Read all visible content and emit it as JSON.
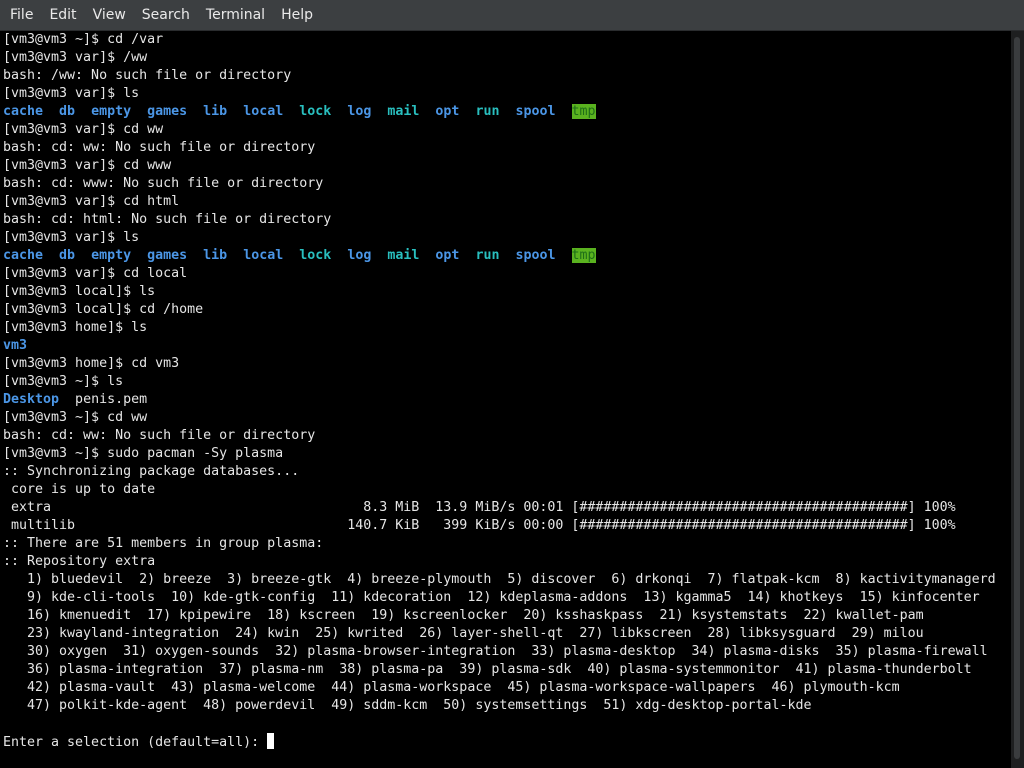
{
  "menu": {
    "items": [
      "File",
      "Edit",
      "View",
      "Search",
      "Terminal",
      "Help"
    ]
  },
  "colors": {
    "menubar_bg": "#3c3f41",
    "terminal_bg": "#000000",
    "text": "#e6e6e6",
    "dir_blue": "#4b96e6",
    "dir_cyan": "#29bfbf",
    "tmp_bg": "#5ab21f"
  },
  "terminal": {
    "lines": [
      [
        {
          "t": "[vm3@vm3 ~]$ cd /var"
        }
      ],
      [
        {
          "t": "[vm3@vm3 var]$ /ww"
        }
      ],
      [
        {
          "t": "bash: /ww: No such file or directory"
        }
      ],
      [
        {
          "t": "[vm3@vm3 var]$ ls"
        }
      ],
      [
        {
          "t": "cache",
          "c": "fg-blue"
        },
        {
          "t": "  "
        },
        {
          "t": "db",
          "c": "fg-blue"
        },
        {
          "t": "  "
        },
        {
          "t": "empty",
          "c": "fg-blue"
        },
        {
          "t": "  "
        },
        {
          "t": "games",
          "c": "fg-blue"
        },
        {
          "t": "  "
        },
        {
          "t": "lib",
          "c": "fg-blue"
        },
        {
          "t": "  "
        },
        {
          "t": "local",
          "c": "fg-blue"
        },
        {
          "t": "  "
        },
        {
          "t": "lock",
          "c": "fg-cyan"
        },
        {
          "t": "  "
        },
        {
          "t": "log",
          "c": "fg-blue"
        },
        {
          "t": "  "
        },
        {
          "t": "mail",
          "c": "fg-cyan"
        },
        {
          "t": "  "
        },
        {
          "t": "opt",
          "c": "fg-blue"
        },
        {
          "t": "  "
        },
        {
          "t": "run",
          "c": "fg-cyan"
        },
        {
          "t": "  "
        },
        {
          "t": "spool",
          "c": "fg-blue"
        },
        {
          "t": "  "
        },
        {
          "t": "tmp",
          "c": "fg-tmp"
        }
      ],
      [
        {
          "t": "[vm3@vm3 var]$ cd ww"
        }
      ],
      [
        {
          "t": "bash: cd: ww: No such file or directory"
        }
      ],
      [
        {
          "t": "[vm3@vm3 var]$ cd www"
        }
      ],
      [
        {
          "t": "bash: cd: www: No such file or directory"
        }
      ],
      [
        {
          "t": "[vm3@vm3 var]$ cd html"
        }
      ],
      [
        {
          "t": "bash: cd: html: No such file or directory"
        }
      ],
      [
        {
          "t": "[vm3@vm3 var]$ ls"
        }
      ],
      [
        {
          "t": "cache",
          "c": "fg-blue"
        },
        {
          "t": "  "
        },
        {
          "t": "db",
          "c": "fg-blue"
        },
        {
          "t": "  "
        },
        {
          "t": "empty",
          "c": "fg-blue"
        },
        {
          "t": "  "
        },
        {
          "t": "games",
          "c": "fg-blue"
        },
        {
          "t": "  "
        },
        {
          "t": "lib",
          "c": "fg-blue"
        },
        {
          "t": "  "
        },
        {
          "t": "local",
          "c": "fg-blue"
        },
        {
          "t": "  "
        },
        {
          "t": "lock",
          "c": "fg-cyan"
        },
        {
          "t": "  "
        },
        {
          "t": "log",
          "c": "fg-blue"
        },
        {
          "t": "  "
        },
        {
          "t": "mail",
          "c": "fg-cyan"
        },
        {
          "t": "  "
        },
        {
          "t": "opt",
          "c": "fg-blue"
        },
        {
          "t": "  "
        },
        {
          "t": "run",
          "c": "fg-cyan"
        },
        {
          "t": "  "
        },
        {
          "t": "spool",
          "c": "fg-blue"
        },
        {
          "t": "  "
        },
        {
          "t": "tmp",
          "c": "fg-tmp"
        }
      ],
      [
        {
          "t": "[vm3@vm3 var]$ cd local"
        }
      ],
      [
        {
          "t": "[vm3@vm3 local]$ ls"
        }
      ],
      [
        {
          "t": "[vm3@vm3 local]$ cd /home"
        }
      ],
      [
        {
          "t": "[vm3@vm3 home]$ ls"
        }
      ],
      [
        {
          "t": "vm3",
          "c": "fg-blue"
        }
      ],
      [
        {
          "t": "[vm3@vm3 home]$ cd vm3"
        }
      ],
      [
        {
          "t": "[vm3@vm3 ~]$ ls"
        }
      ],
      [
        {
          "t": "Desktop",
          "c": "fg-blue"
        },
        {
          "t": "  penis.pem"
        }
      ],
      [
        {
          "t": "[vm3@vm3 ~]$ cd ww"
        }
      ],
      [
        {
          "t": "bash: cd: ww: No such file or directory"
        }
      ],
      [
        {
          "t": "[vm3@vm3 ~]$ sudo pacman -Sy plasma"
        }
      ],
      [
        {
          "t": ":: Synchronizing package databases..."
        }
      ],
      [
        {
          "t": " core is up to date"
        }
      ],
      [
        {
          "t": " extra                                       8.3 MiB  13.9 MiB/s 00:01 [#########################################] 100%"
        }
      ],
      [
        {
          "t": " multilib                                  140.7 KiB   399 KiB/s 00:00 [#########################################] 100%"
        }
      ],
      [
        {
          "t": ":: There are 51 members in group plasma:"
        }
      ],
      [
        {
          "t": ":: Repository extra"
        }
      ],
      [
        {
          "t": "   1) bluedevil  2) breeze  3) breeze-gtk  4) breeze-plymouth  5) discover  6) drkonqi  7) flatpak-kcm  8) kactivitymanagerd"
        }
      ],
      [
        {
          "t": "   9) kde-cli-tools  10) kde-gtk-config  11) kdecoration  12) kdeplasma-addons  13) kgamma5  14) khotkeys  15) kinfocenter"
        }
      ],
      [
        {
          "t": "   16) kmenuedit  17) kpipewire  18) kscreen  19) kscreenlocker  20) ksshaskpass  21) ksystemstats  22) kwallet-pam"
        }
      ],
      [
        {
          "t": "   23) kwayland-integration  24) kwin  25) kwrited  26) layer-shell-qt  27) libkscreen  28) libksysguard  29) milou"
        }
      ],
      [
        {
          "t": "   30) oxygen  31) oxygen-sounds  32) plasma-browser-integration  33) plasma-desktop  34) plasma-disks  35) plasma-firewall"
        }
      ],
      [
        {
          "t": "   36) plasma-integration  37) plasma-nm  38) plasma-pa  39) plasma-sdk  40) plasma-systemmonitor  41) plasma-thunderbolt"
        }
      ],
      [
        {
          "t": "   42) plasma-vault  43) plasma-welcome  44) plasma-workspace  45) plasma-workspace-wallpapers  46) plymouth-kcm"
        }
      ],
      [
        {
          "t": "   47) polkit-kde-agent  48) powerdevil  49) sddm-kcm  50) systemsettings  51) xdg-desktop-portal-kde"
        }
      ],
      [
        {
          "t": ""
        }
      ],
      [
        {
          "t": "Enter a selection (default=all): "
        }
      ]
    ]
  }
}
